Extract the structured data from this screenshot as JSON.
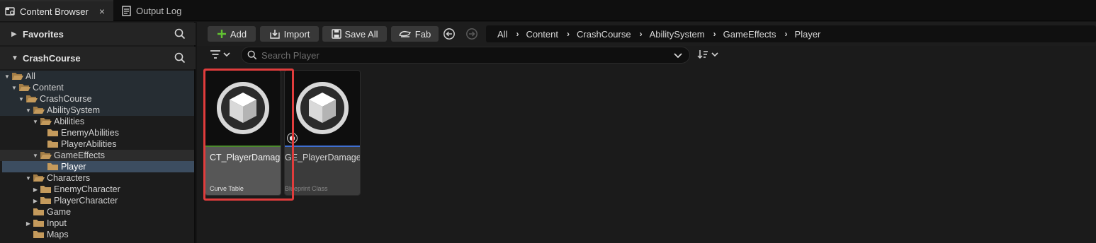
{
  "tabs": [
    {
      "label": "Content Browser",
      "icon": "content-browser-icon",
      "active": true,
      "close": "×"
    },
    {
      "label": "Output Log",
      "icon": "output-log-icon",
      "active": false
    }
  ],
  "sidebar": {
    "favorites": {
      "label": "Favorites"
    },
    "project": {
      "label": "CrashCourse"
    },
    "tree": [
      {
        "label": "All",
        "depth": 0,
        "expanded": true
      },
      {
        "label": "Content",
        "depth": 1,
        "expanded": true
      },
      {
        "label": "CrashCourse",
        "depth": 2,
        "expanded": true
      },
      {
        "label": "AbilitySystem",
        "depth": 3,
        "expanded": true
      },
      {
        "label": "Abilities",
        "depth": 4,
        "expanded": true
      },
      {
        "label": "EnemyAbilities",
        "depth": 5
      },
      {
        "label": "PlayerAbilities",
        "depth": 5
      },
      {
        "label": "GameEffects",
        "depth": 4,
        "expanded": true
      },
      {
        "label": "Player",
        "depth": 5,
        "selected": true
      },
      {
        "label": "Characters",
        "depth": 3,
        "expanded": true
      },
      {
        "label": "EnemyCharacter",
        "depth": 4,
        "collapsed": true
      },
      {
        "label": "PlayerCharacter",
        "depth": 4,
        "collapsed": true
      },
      {
        "label": "Game",
        "depth": 3
      },
      {
        "label": "Input",
        "depth": 3,
        "collapsed": true
      },
      {
        "label": "Maps",
        "depth": 3
      }
    ]
  },
  "toolbar": {
    "add_label": "Add",
    "import_label": "Import",
    "save_all_label": "Save All",
    "fab_label": "Fab"
  },
  "breadcrumbs": [
    "All",
    "Content",
    "CrashCourse",
    "AbilitySystem",
    "GameEffects",
    "Player"
  ],
  "search": {
    "placeholder": "Search Player",
    "value": ""
  },
  "assets": [
    {
      "name": "CT_PlayerDamage",
      "type": "Curve Table",
      "strip_color": "#4c8a2e",
      "selected": true
    },
    {
      "name": "GE_PlayerDamage",
      "type": "Blueprint Class",
      "strip_color": "#3f6fd1",
      "selected": false
    }
  ],
  "colors": {
    "accent_green": "#62c332",
    "selection_red": "#e03c3c",
    "tree_selected": "#3c4d60",
    "folder": "#c49a5c"
  }
}
